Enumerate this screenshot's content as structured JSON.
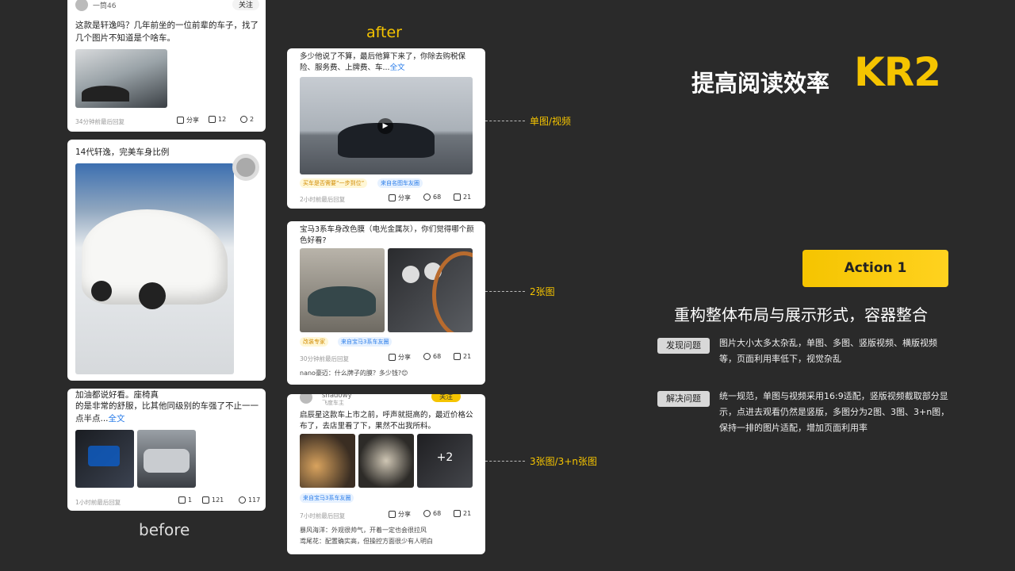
{
  "before_label": "before",
  "after_label": "after",
  "heading": {
    "title": "提高阅读效率",
    "kr": "KR2"
  },
  "action_button": "Action 1",
  "subtitle": "重构整体布局与展示形式，容器整合",
  "problem": {
    "label": "发现问题",
    "text": "图片大小太多太杂乱，单图、多图、竖版视频、横版视频等，页面利用率低下，视觉杂乱"
  },
  "solution": {
    "label": "解决问题",
    "text": "统一规范，单图与视频采用16:9适配，竖版视频截取部分显示，点进去观看仍然是竖版，多图分为2图、3图、3+n图，保持一排的图片适配，增加页面利用率"
  },
  "annotations": [
    "单图/视频",
    "2张图",
    "3张图/3+n张图"
  ],
  "before_cards": [
    {
      "user": "一筒46",
      "follow": "关注",
      "text": "这款是轩逸吗？几年前坐的一位前辈的车子，找了几个图片不知道是个啥车。",
      "time": "34分钟前最后回复",
      "share": "分享",
      "comments": "12",
      "likes": "2"
    },
    {
      "text": "14代轩逸，完美车身比例"
    },
    {
      "text1": "加油都说好看。座椅真",
      "text2": "的是非常的舒服，比其他同级别的车强了不止一一点半点...",
      "more": "全文",
      "time": "1小时前最后回复",
      "shares": "1",
      "comments": "121",
      "likes": "117"
    }
  ],
  "after_cards": [
    {
      "text": "多少他说了不算，最后他算下来了，你除去购税保险、服务费、上牌费、车...",
      "more": "全文",
      "tag1": "买车是否需要“一步到位”",
      "tag2": "来自名图车友圈",
      "time": "2小时前最后回复",
      "share": "分享",
      "comments": "68",
      "likes": "21"
    },
    {
      "text": "宝马3系车身改色膜（电光金属灰），你们觉得哪个颜色好看?",
      "tag1": "改装专家",
      "tag2": "来自宝马3系车友圈",
      "time": "30分钟前最后回复",
      "share": "分享",
      "comments": "68",
      "likes": "21",
      "reply": "nano豪迈：什么牌子的膜？多少钱?😊"
    },
    {
      "user": "shadowy",
      "sub": "飞度车主",
      "follow": "关注",
      "text": "启辰星这款车上市之前，呼声就挺高的，最近价格公布了，去店里看了下，果然不出我所料。",
      "plus": "+2",
      "tag": "来自宝马3系车友圈",
      "time": "7小时前最后回复",
      "share": "分享",
      "comments": "68",
      "likes": "21",
      "reply1": "暴风海洋：外观很帅气，开着一定也会很拉风",
      "reply2": "鸢尾花：配置确实高，但操控方面很少有人明白"
    }
  ],
  "colors": {
    "accent": "#f5c400",
    "bg": "#2a2a2a",
    "link": "#2b7de9"
  }
}
